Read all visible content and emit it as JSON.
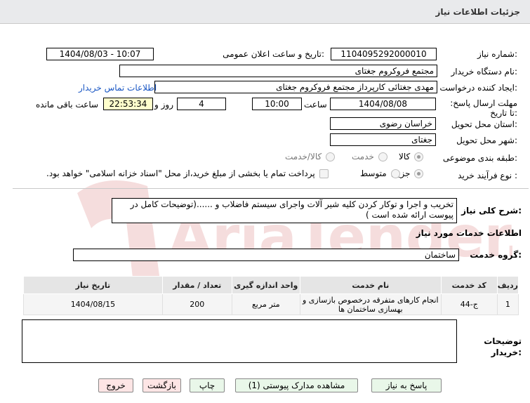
{
  "header": {
    "title": "جزئیات اطلاعات نیاز"
  },
  "fields": {
    "need_number_label": "شماره نیاز:",
    "need_number": "1104095292000010",
    "announce_datetime_label": "تاریخ و ساعت اعلان عمومی:",
    "announce_datetime": "1404/08/03 - 10:07",
    "buyer_org_label": "نام دستگاه خریدار:",
    "buyer_org": "مجتمع فروکروم جغتای",
    "creator_label": "ایجاد کننده درخواست:",
    "creator": "مهدی جغتائی کارپرداز مجتمع فروکروم جغتای",
    "buyer_contact_link": "اطلاعات تماس خریدار",
    "deadline_label": "مهلت ارسال پاسخ: تا تاریخ:",
    "deadline_date": "1404/08/08",
    "time_label": "ساعت",
    "deadline_time": "10:00",
    "days": "4",
    "days_label": "روز و",
    "remaining_time": "22:53:34",
    "remaining_label": "ساعت باقی مانده",
    "province_label": "استان محل تحویل:",
    "province": "خراسان رضوی",
    "city_label": "شهر محل تحویل:",
    "city": "جغتای",
    "category_label": "طبقه بندی موضوعی:",
    "category_options": [
      "کالا",
      "خدمت",
      "کالا/خدمت"
    ],
    "process_label": "نوع فرآیند خرید :",
    "process_options": [
      "جزیی",
      "متوسط"
    ],
    "payment_note": "پرداخت تمام یا بخشی از مبلغ خرید،از محل \"اسناد خزانه اسلامی\" خواهد بود."
  },
  "description": {
    "label": "شرح کلی نیاز:",
    "text": "تخریب و اجرا و توکار کردن کلیه شیر آلات واجرای سیستم فاضلاب و ......(توضیحات کامل در پیوست ارائه شده است )"
  },
  "services": {
    "section_title": "اطلاعات خدمات مورد نیاز",
    "group_label": "گروه خدمت:",
    "group_value": "ساختمان"
  },
  "table": {
    "headers": [
      "ردیف",
      "کد خدمت",
      "نام خدمت",
      "واحد اندازه گیری",
      "تعداد / مقدار",
      "تاریخ نیاز"
    ],
    "rows": [
      [
        "1",
        "ج-44",
        "انجام کارهای متفرقه درخصوص بازسازی و بهسازی ساختمان ها",
        "متر مربع",
        "200",
        "1404/08/15"
      ]
    ]
  },
  "buyer_notes": {
    "label": "توضیحات خریدار:",
    "value": ""
  },
  "buttons": {
    "reply": "پاسخ به نیاز",
    "view_docs": "مشاهده مدارک پیوستی (1)",
    "print": "چاپ",
    "back": "بازگشت",
    "exit": "خروج"
  },
  "watermark_text": "AriaTender.net",
  "colors": {
    "link": "#1a57c4",
    "header_bg": "#e9eaec",
    "remaining_bg": "#ffffcc",
    "button_green": "#e9f7e9",
    "button_pink": "#fde5e5"
  }
}
